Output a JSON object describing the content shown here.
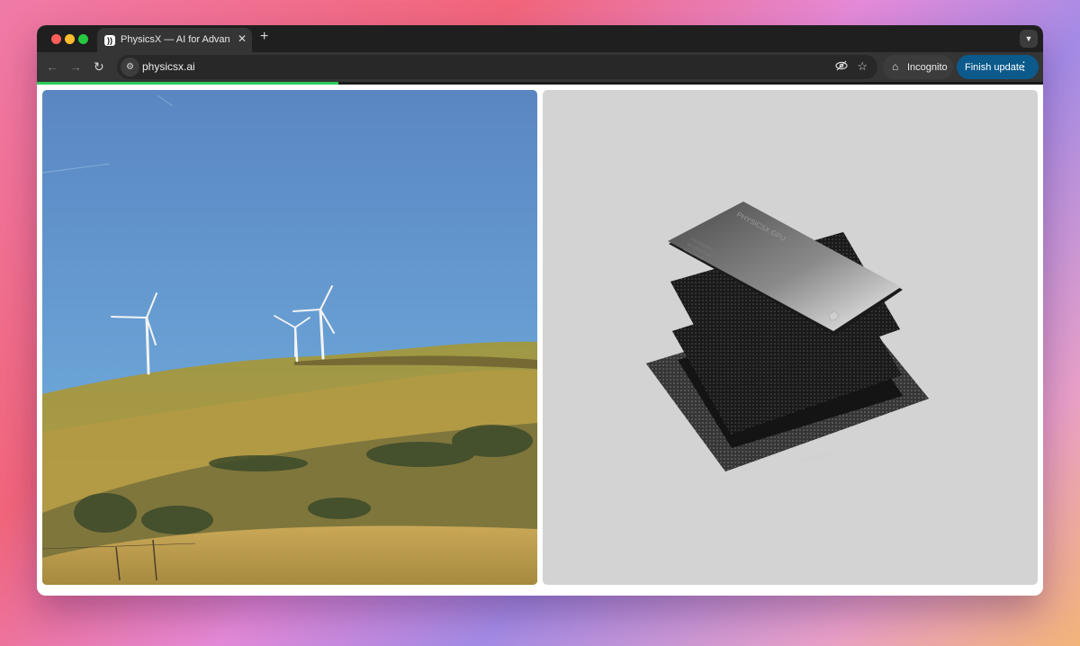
{
  "browser": {
    "tab": {
      "favicon": "physicsx-logo-icon",
      "title": "PhysicsX — AI for Advanced E"
    },
    "new_tab_icon": "plus-icon",
    "tab_search_icon": "chevron-down-icon",
    "nav": {
      "back_icon": "arrow-left-icon",
      "forward_icon": "arrow-right-icon",
      "reload_icon": "reload-icon"
    },
    "address": {
      "url": "physicsx.ai",
      "site_info_icon": "tune-icon"
    },
    "omnibox_icons": [
      "eye-off-icon",
      "star-icon"
    ],
    "incognito_label": "Incognito",
    "finish_update_label": "Finish update",
    "page_load_progress": 0.3,
    "colors": {
      "accent_progress": "#2bcb5a",
      "finish_button": "#0b5a8b"
    }
  },
  "page": {
    "left_image": "wind-turbines-on-hillside",
    "right_image": "physicsx-gpu-layered-chip",
    "chip": {
      "top_label": "PHYSICSX GPU",
      "top_small_lines": [
        "ENGINEERING",
        "ARCHITECTURE",
        "SIMULATION"
      ],
      "base_label": "PHYSICSX"
    }
  }
}
